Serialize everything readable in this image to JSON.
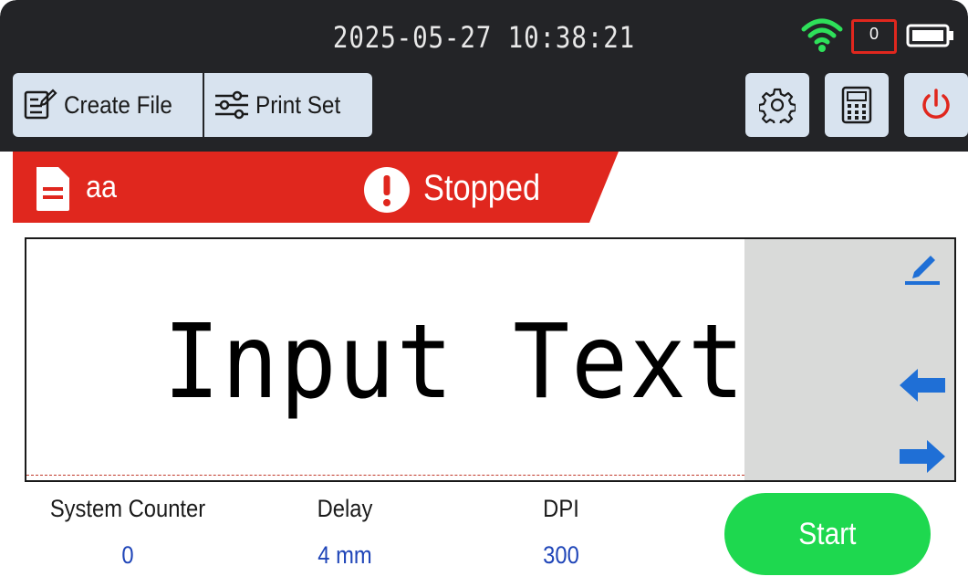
{
  "status_bar": {
    "datetime": "2025-05-27  10:38:21",
    "card_count": "0",
    "wifi_color": "#2ee05a",
    "card_color": "#e0271e"
  },
  "toolbar": {
    "create_file_label": "Create  File",
    "print_set_label": "Print  Set",
    "create_file_icon": "edit-document-icon",
    "print_set_icon": "sliders-icon",
    "settings_icon": "gear-icon",
    "calculator_icon": "calculator-icon",
    "power_icon": "power-icon",
    "power_color": "#e0271e"
  },
  "job": {
    "file_name": "aa",
    "state": "Stopped",
    "file_icon": "document-icon",
    "state_icon": "alert-icon",
    "band_color": "#e0271e"
  },
  "preview": {
    "text": "Input Text",
    "edit_icon": "pencil-icon",
    "left_icon": "arrow-left-icon",
    "right_icon": "arrow-right-icon",
    "accent": "#1f6fd6"
  },
  "stats": {
    "counter_label": "System  Counter",
    "counter_value": "0",
    "delay_label": "Delay",
    "delay_value": "4  mm",
    "dpi_label": "DPI",
    "dpi_value": "300"
  },
  "actions": {
    "start_label": "Start",
    "start_color": "#1ed84f"
  }
}
